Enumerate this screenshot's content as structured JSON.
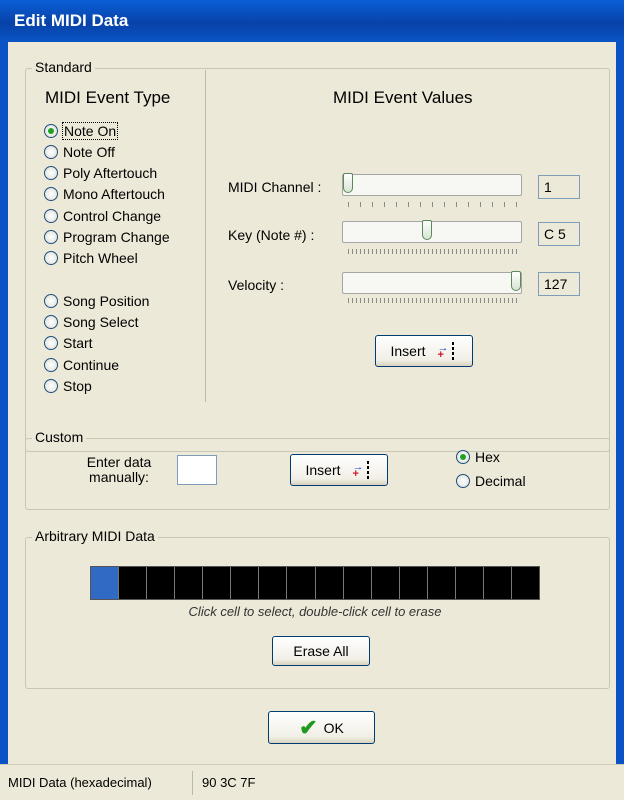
{
  "window": {
    "title": "Edit MIDI Data"
  },
  "standard": {
    "group_title": "Standard",
    "event_type_heading": "MIDI Event Type",
    "event_types": [
      {
        "label": "Note On",
        "selected": true
      },
      {
        "label": "Note Off",
        "selected": false
      },
      {
        "label": "Poly Aftertouch",
        "selected": false
      },
      {
        "label": "Mono Aftertouch",
        "selected": false
      },
      {
        "label": "Control Change",
        "selected": false
      },
      {
        "label": "Program Change",
        "selected": false
      },
      {
        "label": "Pitch Wheel",
        "selected": false
      },
      {
        "label": "Song Position",
        "selected": false
      },
      {
        "label": "Song Select",
        "selected": false
      },
      {
        "label": "Start",
        "selected": false
      },
      {
        "label": "Continue",
        "selected": false
      },
      {
        "label": "Stop",
        "selected": false
      }
    ],
    "values_heading": "MIDI Event Values",
    "channel": {
      "label": "MIDI Channel :",
      "value": "1",
      "level": 0
    },
    "key": {
      "label": "Key (Note #) :",
      "value": "C 5",
      "level": 0.47
    },
    "velocity": {
      "label": "Velocity :",
      "value": "127",
      "level": 1
    },
    "insert_label": "Insert"
  },
  "custom": {
    "group_title": "Custom",
    "enter_label": "Enter data manually:",
    "input_value": "",
    "insert_label": "Insert",
    "format_options": [
      {
        "label": "Hex",
        "selected": true
      },
      {
        "label": "Decimal",
        "selected": false
      }
    ]
  },
  "arbitrary": {
    "group_title": "Arbitrary MIDI Data",
    "cell_count": 16,
    "selected_cell": 0,
    "hint": "Click cell to select, double-click cell to erase",
    "erase_all_label": "Erase All"
  },
  "ok_label": "OK",
  "status": {
    "label": "MIDI Data (hexadecimal)",
    "value": "90 3C 7F"
  },
  "colors": {
    "title_bar": "#0a54c4",
    "selected_cell": "#316ac5",
    "radio_dot": "#21a121",
    "ok_check": "#1f9a1f"
  },
  "icons": {
    "insert": "insert-arrows-icon",
    "ok": "checkmark-icon"
  }
}
